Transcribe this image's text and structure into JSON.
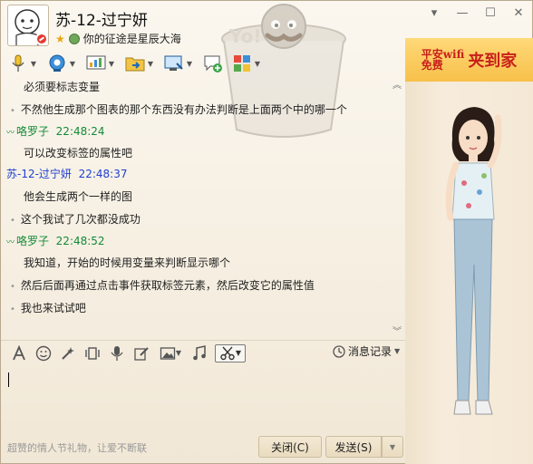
{
  "window": {
    "title": "苏-12-过宁妍",
    "signature": "你的征途是星辰大海",
    "avatar_text": "头像",
    "buttons": [
      "▾",
      "—",
      "☐",
      "✕"
    ]
  },
  "ad": {
    "line1": "平安wifi",
    "line2": "免费",
    "line3": "夹到家"
  },
  "toolbar": {
    "items": [
      {
        "icon": "microphone-icon"
      },
      {
        "icon": "webcam-icon"
      },
      {
        "icon": "screen-share-icon"
      },
      {
        "icon": "file-transfer-icon"
      },
      {
        "icon": "remote-desktop-icon"
      },
      {
        "icon": "add-discussion-icon"
      },
      {
        "icon": "apps-icon"
      }
    ]
  },
  "chat": {
    "messages": [
      {
        "kind": "text",
        "text": "必须要标志变量"
      },
      {
        "kind": "text_bullet",
        "text": "不然他生成那个图表的那个东西没有办法判断是上面两个中的哪一个"
      },
      {
        "kind": "sender",
        "color": "green",
        "name": "咯罗子",
        "time": "22:48:24"
      },
      {
        "kind": "text",
        "text": "可以改变标签的属性吧"
      },
      {
        "kind": "sender",
        "color": "blue",
        "name": "苏-12-过宁妍",
        "time": "22:48:37"
      },
      {
        "kind": "text",
        "text": "他会生成两个一样的图"
      },
      {
        "kind": "text_bullet",
        "text": "这个我试了几次都没成功"
      },
      {
        "kind": "sender",
        "color": "green",
        "name": "咯罗子",
        "time": "22:48:52"
      },
      {
        "kind": "text",
        "text": "我知道，开始的时候用变量来判断显示哪个"
      },
      {
        "kind": "text_bullet",
        "text": "然后后面再通过点击事件获取标签元素，然后改变它的属性值"
      },
      {
        "kind": "text_bullet",
        "text": "我也来试试吧"
      }
    ]
  },
  "input_toolbar": {
    "history_label": "消息记录"
  },
  "bottom": {
    "promo": "超赞的情人节礼物，让爱不断联",
    "close_label": "关闭(C)",
    "send_label": "发送(S)"
  }
}
